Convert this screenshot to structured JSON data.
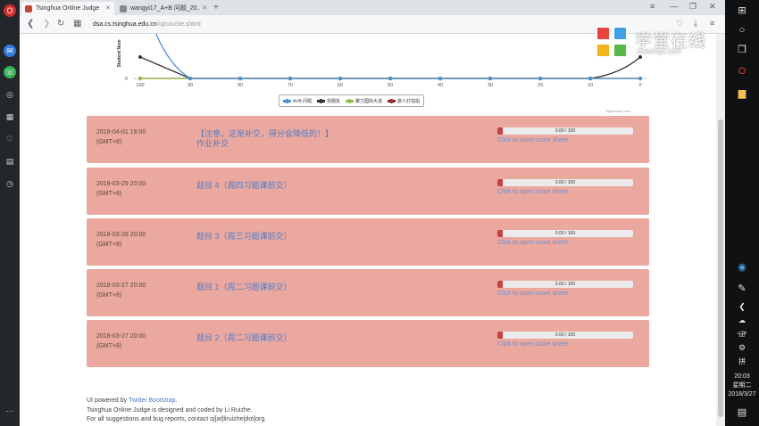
{
  "browser": {
    "tabs": [
      {
        "title": "Tsinghua Online Judge",
        "active": true
      },
      {
        "title": "wangyi17_A+B 问题_20..",
        "active": false
      }
    ],
    "address": {
      "host": "dsa.cs.tsinghua.edu.cn",
      "path": "/oj/course.shtml"
    }
  },
  "chart_data": {
    "type": "line",
    "x": [
      100,
      90,
      80,
      70,
      60,
      50,
      40,
      30,
      20,
      10,
      0
    ],
    "xlim": [
      100,
      0
    ],
    "ylabel": "Student Num",
    "y_ticks": [
      0
    ],
    "series": [
      {
        "name": "A+B 问题",
        "color": "#4a90d9",
        "values": [
          14,
          0,
          0,
          0,
          0,
          0,
          0,
          0,
          0,
          0,
          0
        ]
      },
      {
        "name": "找朋友",
        "color": "#333333",
        "values": [
          3,
          0,
          0,
          0,
          0,
          0,
          0,
          0,
          0,
          0,
          3
        ]
      },
      {
        "name": "聚力国际大道",
        "color": "#8bbf4a",
        "values": [
          0,
          0,
          0,
          0,
          0,
          0,
          0,
          0,
          0,
          0,
          0
        ]
      },
      {
        "name": "旅人打拍拍",
        "color": "#8b2a2a",
        "values": [
          0,
          0,
          0,
          0,
          0,
          0,
          0,
          0,
          0,
          0,
          0
        ]
      }
    ],
    "credits": "Highcharts.com"
  },
  "homework": [
    {
      "date": "2018-04-01 19:00",
      "tz": "(GMT+8)",
      "title": "【注意，这是补交，得分会降低的！】作业补交",
      "score": 0,
      "max": 100,
      "score_text": "0.00 / 100",
      "link": "Click to open score sheet"
    },
    {
      "date": "2018-03-29 20:00",
      "tz": "(GMT+8)",
      "title": "题目 4（周四习题课前交）",
      "score": 0,
      "max": 100,
      "score_text": "0.00 / 100",
      "link": "Click to open score sheet"
    },
    {
      "date": "2018-03-28 20:00",
      "tz": "(GMT+8)",
      "title": "题目 3（周三习题课前交）",
      "score": 0,
      "max": 100,
      "score_text": "0.00 / 100",
      "link": "Click to open score sheet"
    },
    {
      "date": "2018-03-27 20:00",
      "tz": "(GMT+8)",
      "title": "题目 1（周二习题课前交）",
      "score": 0,
      "max": 100,
      "score_text": "0.00 / 100",
      "link": "Click to open score sheet"
    },
    {
      "date": "2018-03-27 20:00",
      "tz": "(GMT+8)",
      "title": "题目 2（周二习题课前交）",
      "score": 0,
      "max": 100,
      "score_text": "0.00 / 100",
      "link": "Click to open score sheet"
    }
  ],
  "footer": {
    "line1_prefix": "UI powered by ",
    "line1_link": "Twitter Bootstrap",
    "line1_suffix": ".",
    "line2": "Tsinghua Online Judge is designed and coded by Li Ruizhe.",
    "line3_prefix": "For all suggestions and bug reports, contact ",
    "line3_email": "oj[at]liruizhe[dot]org",
    "line3_suffix": "."
  },
  "watermark": {
    "title": "学堂在线",
    "subtitle": "xuetangx.com"
  },
  "taskbar": {
    "time": "20:03",
    "weekday": "星期二",
    "date": "2018/3/27"
  },
  "colors": {
    "row_bg": "#eba89e",
    "link": "#4f7cc8",
    "progress_fill": "#c84141"
  }
}
